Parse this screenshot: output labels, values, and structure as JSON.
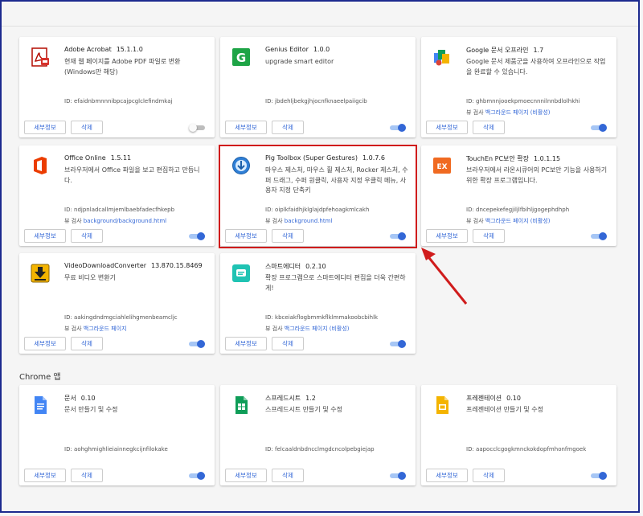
{
  "section_chrome_apps": "Chrome 앱",
  "buttons": {
    "detail": "세부정보",
    "remove": "삭제"
  },
  "cards": [
    {
      "name": "Adobe Acrobat",
      "version": "15.1.1.0",
      "desc": "현재 웹 페이지를 Adobe PDF 파일로 변환(Windows만 해당)",
      "id": "ID: efaidnbmnnnibpcajpcglclefindmkaj",
      "view_label": "",
      "view_link": "",
      "enabled": false,
      "icon": "acrobat-icon"
    },
    {
      "name": "Genius Editor",
      "version": "1.0.0",
      "desc": "upgrade smart editor",
      "id": "ID: jbdehljbekgjhjocnfknaeelpaiigcib",
      "view_label": "",
      "view_link": "",
      "enabled": true,
      "icon": "genius-editor-icon"
    },
    {
      "name": "Google 문서 오프라인",
      "version": "1.7",
      "desc": "Google 문서 제품군을 사용하여 오프라인으로 작업을 완료할 수 있습니다.",
      "id": "ID: ghbmnnjooekpmoecnnnilnnbdlolhkhi",
      "view_label": "뷰 검사",
      "view_link": "백그라운드 페이지 (비활성)",
      "enabled": true,
      "icon": "google-docs-offline-icon"
    },
    {
      "name": "Office Online",
      "version": "1.5.11",
      "desc": "브라우저에서 Office 파일을 보고 편집하고 만듭니다.",
      "id": "ID: ndjpnladcallmjemlbaebfadecfhkepb",
      "view_label": "뷰 검사",
      "view_link": "background/background.html",
      "enabled": true,
      "icon": "office-icon"
    },
    {
      "name": "Pig Toolbox (Super Gestures)",
      "version": "1.0.7.6",
      "desc": "마우스 제스처, 마우스 휠 제스처, Rocker 제스처, 수퍼 드래그, 수퍼 원클릭, 사용자 지정 우클릭 메뉴, 사용자 지정 단축키",
      "id": "ID: oiplkfaidhjklglajdpfehoagkmlcakh",
      "view_label": "뷰 검사",
      "view_link": "background.html",
      "enabled": true,
      "icon": "pig-toolbox-icon"
    },
    {
      "name": "TouchEn PC보안 확장",
      "version": "1.0.1.15",
      "desc": "브라우저에서 라온시큐어의 PC보안 기능을 사용하기 위한 확장 프로그램입니다.",
      "id": "ID: dncepekefegjiljlfbihljgogephdhph",
      "view_label": "뷰 검사",
      "view_link": "백그라운드 페이지 (비활성)",
      "enabled": true,
      "icon": "touchen-icon"
    },
    {
      "name": "VideoDownloadConverter",
      "version": "13.870.15.8469",
      "desc": "무료 비디오 변환기",
      "id": "ID: aakingdndmgciahlelihgmenbeamcljc",
      "view_label": "뷰 검사",
      "view_link": "백그라운드 페이지",
      "enabled": true,
      "icon": "video-download-icon"
    },
    {
      "name": "스마트에디터",
      "version": "0.2.10",
      "desc": "확장 프로그램으로 스마트에디터 편집을 더욱 간편하게!",
      "id": "ID: kbceiakflogbmmkflklmmakoobcbihlk",
      "view_label": "뷰 검사",
      "view_link": "백그라운드 페이지 (비활성)",
      "enabled": true,
      "icon": "smart-editor-icon"
    }
  ],
  "apps": [
    {
      "name": "문서",
      "version": "0.10",
      "desc": "문서 만들기 및 수정",
      "id": "ID: aohghmighlieiainnegkcijnfilokake",
      "view_label": "",
      "view_link": "",
      "enabled": true,
      "icon": "docs-icon"
    },
    {
      "name": "스프레드시트",
      "version": "1.2",
      "desc": "스프레드시트 만들기 및 수정",
      "id": "ID: felcaaldnbdncclmgdcncolpebgiejap",
      "view_label": "",
      "view_link": "",
      "enabled": true,
      "icon": "sheets-icon"
    },
    {
      "name": "프레젠테이션",
      "version": "0.10",
      "desc": "프레젠테이션 만들기 및 수정",
      "id": "ID: aapocclcgogkmnckokdopfmhonfmgoek",
      "view_label": "",
      "view_link": "",
      "enabled": true,
      "icon": "slides-icon"
    }
  ]
}
